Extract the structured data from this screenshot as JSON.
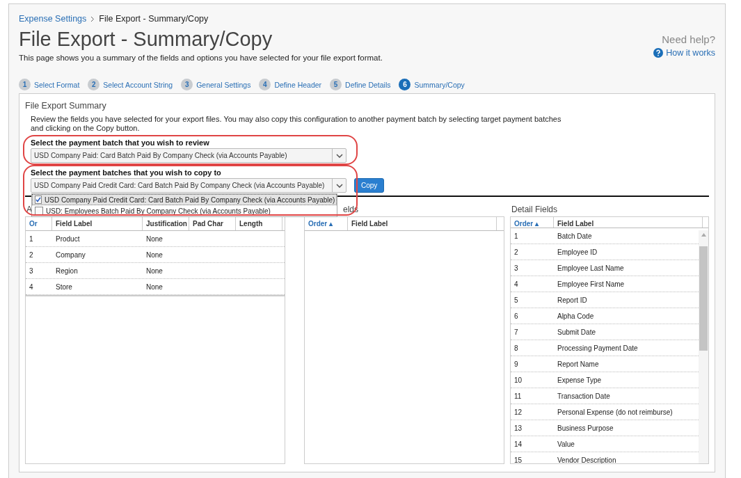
{
  "breadcrumb": {
    "link": "Expense Settings",
    "current": "File Export - Summary/Copy"
  },
  "title": "File Export - Summary/Copy",
  "subtitle": "This page shows you a summary of the fields and options you have selected for your file export format.",
  "help": {
    "heading": "Need help?",
    "link": "How it works"
  },
  "steps": [
    {
      "number": "1",
      "label": "Select Format",
      "selected": false
    },
    {
      "number": "2",
      "label": "Select Account String",
      "selected": false
    },
    {
      "number": "3",
      "label": "General Settings",
      "selected": false
    },
    {
      "number": "4",
      "label": "Define Header",
      "selected": false
    },
    {
      "number": "5",
      "label": "Define Details",
      "selected": false
    },
    {
      "number": "6",
      "label": "Summary/Copy",
      "selected": true
    }
  ],
  "summary": {
    "title": "File Export Summary",
    "description": "Review the fields you have selected for your export files. You may also copy this configuration to another payment batch by selecting target payment batches and clicking on the Copy button.",
    "review": {
      "label": "Select the payment batch that you wish to review",
      "value": "USD Company Paid: Card Batch Paid By Company Check (via Accounts Payable)"
    },
    "copy": {
      "label": "Select the payment batches that you wish to copy to",
      "value": "USD Company Paid Credit Card: Card Batch Paid By Company Check (via Accounts Payable)",
      "button": "Copy"
    },
    "options": [
      {
        "label": "USD Company Paid Credit Card: Card Batch Paid By Company Check (via Accounts Payable)",
        "checked": true,
        "selected": true
      },
      {
        "label": "USD: Employees Batch Paid By Company Check (via Accounts Payable)",
        "checked": false,
        "selected": false
      }
    ]
  },
  "panels": [
    {
      "title": "A",
      "columns": [
        {
          "label": "Or",
          "kind": "sort"
        },
        {
          "label": "Field Label",
          "kind": "plain"
        },
        {
          "label": "Justification",
          "kind": "plain"
        },
        {
          "label": "Pad Char",
          "kind": "plain"
        },
        {
          "label": "Length",
          "kind": "plain"
        }
      ],
      "rows": [
        [
          "1",
          "Product",
          "None"
        ],
        [
          "2",
          "Company",
          "None"
        ],
        [
          "3",
          "Region",
          "None"
        ],
        [
          "4",
          "Store",
          "None"
        ]
      ]
    },
    {
      "title": "elds",
      "columns": [
        {
          "label": "Order ▴",
          "kind": "sort"
        },
        {
          "label": "Field Label",
          "kind": "plain"
        }
      ]
    },
    {
      "title": "Detail Fields",
      "columns": [
        {
          "label": "Order ▴",
          "kind": "sort"
        },
        {
          "label": "Field Label",
          "kind": "plain"
        }
      ],
      "rows": [
        [
          "1",
          "Batch Date"
        ],
        [
          "2",
          "Employee ID"
        ],
        [
          "3",
          "Employee Last Name"
        ],
        [
          "4",
          "Employee First Name"
        ],
        [
          "5",
          "Report ID"
        ],
        [
          "6",
          "Alpha Code"
        ],
        [
          "7",
          "Submit Date"
        ],
        [
          "8",
          "Processing Payment Date"
        ],
        [
          "9",
          "Report Name"
        ],
        [
          "10",
          "Expense Type"
        ],
        [
          "11",
          "Transaction Date"
        ],
        [
          "12",
          "Personal Expense (do not reimburse)"
        ],
        [
          "13",
          "Business Purpose"
        ],
        [
          "14",
          "Value"
        ],
        [
          "15",
          "Vendor Description"
        ]
      ]
    }
  ]
}
